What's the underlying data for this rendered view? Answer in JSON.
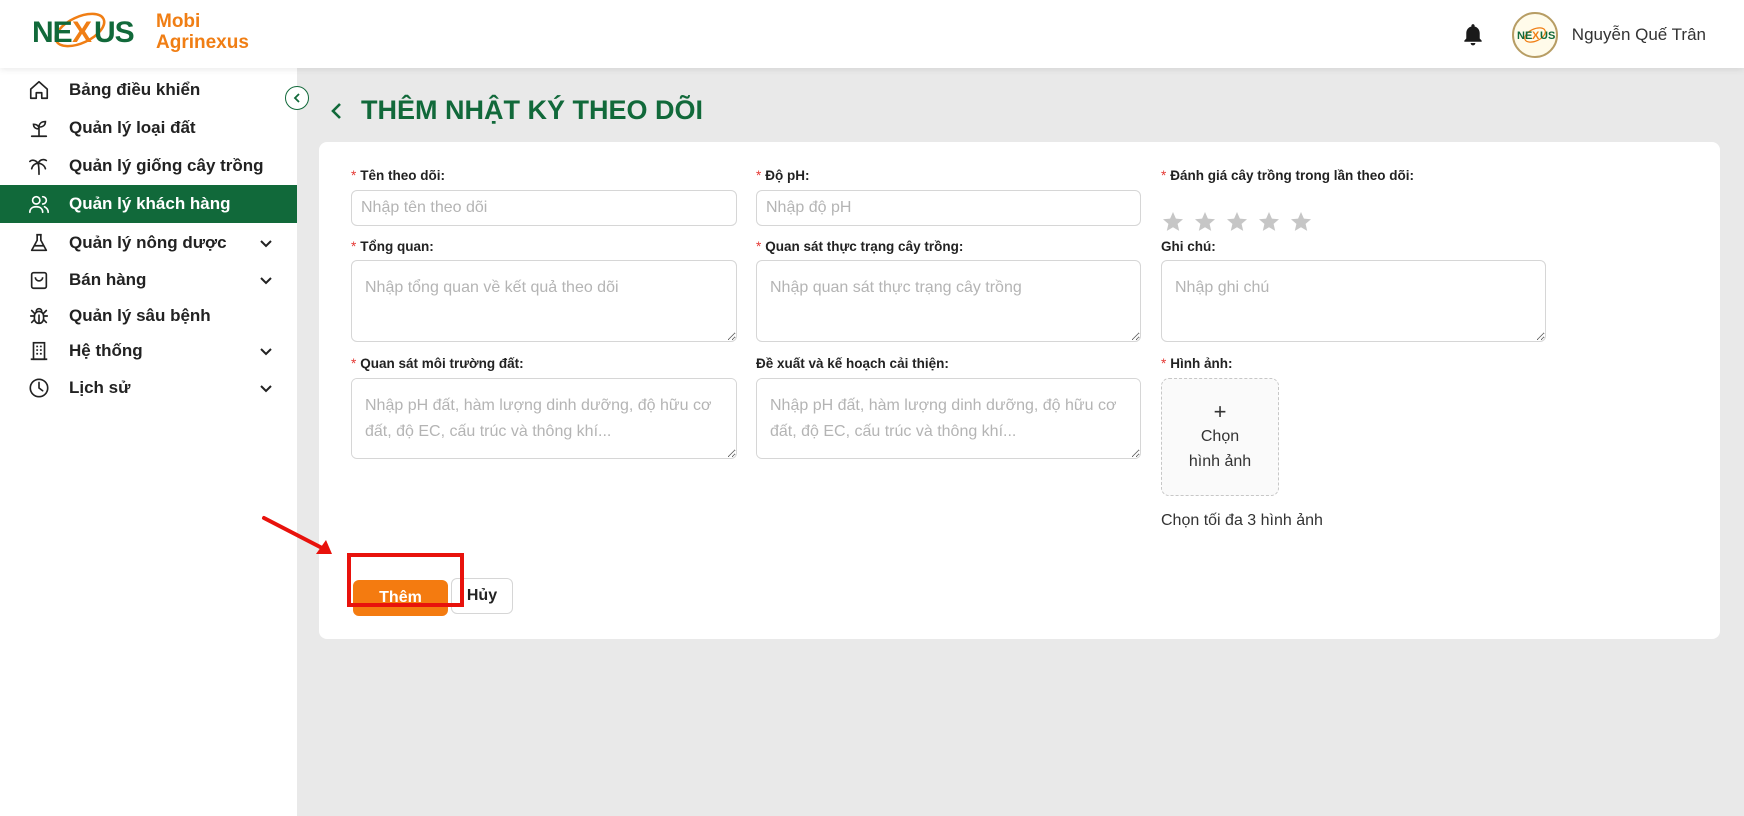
{
  "brand": {
    "name_line1": "Mobi",
    "name_line2": "Agrinexus",
    "logo_text": "NEXUS"
  },
  "header": {
    "user_name": "Nguyễn Quế Trân"
  },
  "sidebar": {
    "items": [
      {
        "label": "Bảng điều khiển",
        "icon": "home-icon",
        "has_submenu": false,
        "active": false
      },
      {
        "label": "Quản lý loại đất",
        "icon": "sprout-icon",
        "has_submenu": false,
        "active": false
      },
      {
        "label": "Quản lý giống cây trồng",
        "icon": "palm-tree-icon",
        "has_submenu": false,
        "active": false
      },
      {
        "label": "Quản lý khách hàng",
        "icon": "users-icon",
        "has_submenu": false,
        "active": true
      },
      {
        "label": "Quản lý nông dược",
        "icon": "flask-icon",
        "has_submenu": true,
        "active": false
      },
      {
        "label": "Bán hàng",
        "icon": "shopping-bag-icon",
        "has_submenu": true,
        "active": false
      },
      {
        "label": "Quản lý sâu bệnh",
        "icon": "bug-icon",
        "has_submenu": false,
        "active": false
      },
      {
        "label": "Hệ thống",
        "icon": "building-icon",
        "has_submenu": true,
        "active": false
      },
      {
        "label": "Lịch sử",
        "icon": "clock-icon",
        "has_submenu": true,
        "active": false
      }
    ]
  },
  "page": {
    "title": "THÊM NHẬT KÝ THEO DÕI"
  },
  "form": {
    "required_mark": "*",
    "name": {
      "label": "Tên theo dõi:",
      "placeholder": "Nhập tên theo dõi",
      "value": ""
    },
    "ph": {
      "label": "Độ pH:",
      "placeholder": "Nhập độ pH",
      "value": ""
    },
    "rating": {
      "label": "Đánh giá cây trồng trong lần theo dõi:",
      "max": 5,
      "value": 0
    },
    "overview": {
      "label": "Tổng quan:",
      "placeholder": "Nhập tổng quan về kết quả theo dõi",
      "value": ""
    },
    "crop_status": {
      "label": "Quan sát thực trạng cây trồng:",
      "placeholder": "Nhập quan sát thực trạng cây trồng",
      "value": ""
    },
    "notes": {
      "label": "Ghi chú:",
      "placeholder": "Nhập ghi chú",
      "value": ""
    },
    "soil_env": {
      "label": "Quan sát môi trường đất:",
      "placeholder": "Nhập pH đất, hàm lượng dinh dưỡng, độ hữu cơ đất, độ EC, cấu trúc và thông khí...",
      "value": ""
    },
    "improvement": {
      "label": "Đề xuất và kế hoạch cải thiện:",
      "placeholder": "Nhập pH đất, hàm lượng dinh dưỡng, độ hữu cơ đất, độ EC, cấu trúc và thông khí...",
      "value": ""
    },
    "images": {
      "label": "Hình ảnh:",
      "upload_plus": "+",
      "upload_line1": "Chọn",
      "upload_line2": "hình ảnh",
      "hint": "Chọn tối đa 3 hình ảnh"
    },
    "submit_label": "Thêm",
    "cancel_label": "Hủy"
  },
  "colors": {
    "brand_green": "#11693a",
    "accent_orange": "#f47b10",
    "required_red": "#e53935",
    "annotation_red": "#e8120c"
  }
}
